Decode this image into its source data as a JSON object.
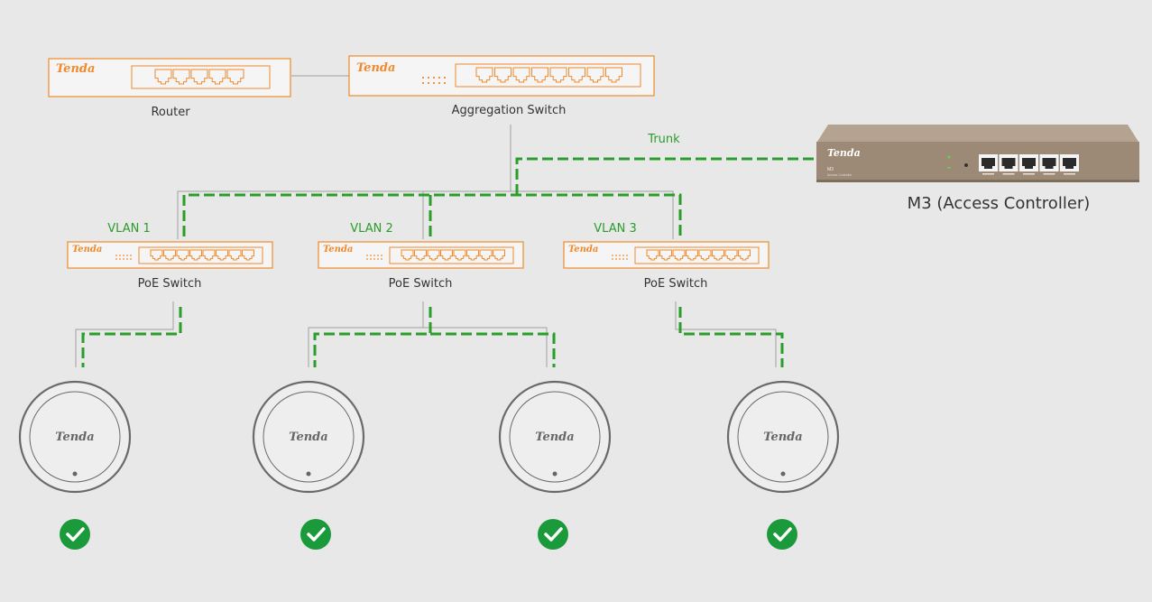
{
  "labels": {
    "router": "Router",
    "aggregation": "Aggregation Switch",
    "trunk": "Trunk",
    "controller": "M3 (Access Controller)",
    "poe": "PoE Switch",
    "vlan1": "VLAN 1",
    "vlan2": "VLAN 2",
    "vlan3": "VLAN 3"
  },
  "brand": {
    "logo": "Tenda",
    "controller_model": "M3",
    "controller_sub": "Access Controller"
  },
  "colors": {
    "accent": "#f08a2c",
    "vlan_green": "#2a9d2a",
    "check_green": "#1a9a3a",
    "controller_body": "#9c8a76"
  },
  "icons": [
    "router-device",
    "switch-device",
    "access-controller-device",
    "access-point-device",
    "check-circle-icon"
  ]
}
